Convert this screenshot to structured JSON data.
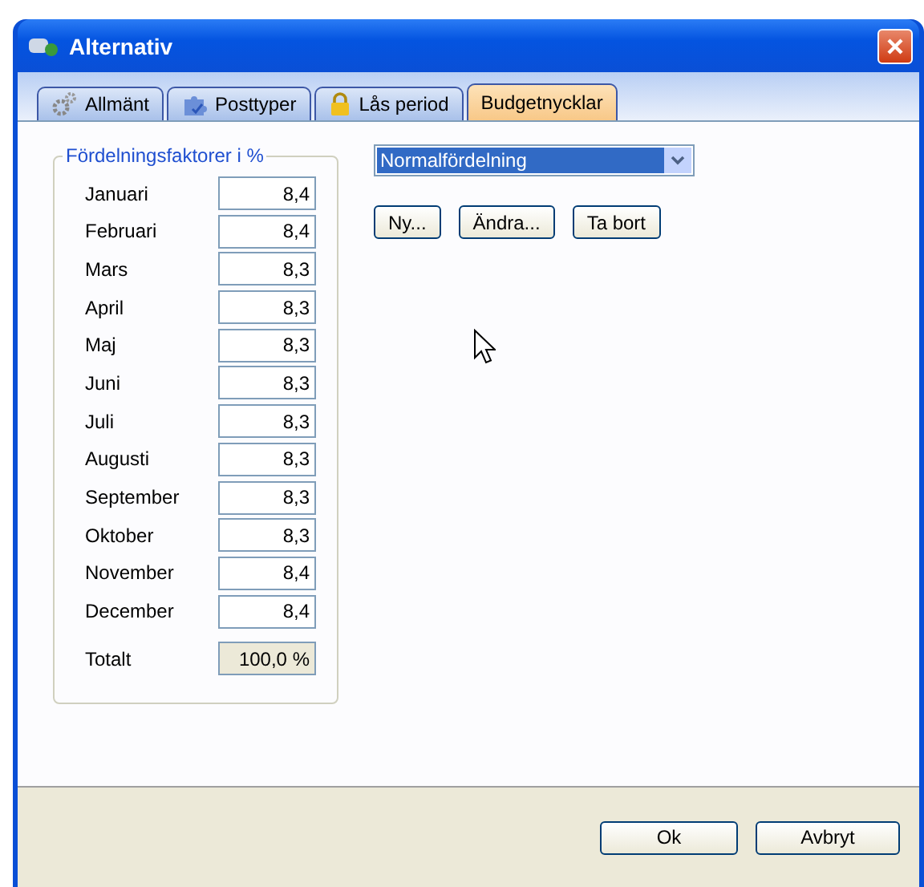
{
  "window": {
    "title": "Alternativ"
  },
  "tabs": [
    {
      "label": "Allmänt",
      "selected": false
    },
    {
      "label": "Posttyper",
      "selected": false
    },
    {
      "label": "Lås period",
      "selected": false
    },
    {
      "label": "Budgetnycklar",
      "selected": true
    }
  ],
  "group": {
    "title": "Fördelningsfaktorer i %",
    "rows": [
      {
        "label": "Januari",
        "value": "8,4"
      },
      {
        "label": "Februari",
        "value": "8,4"
      },
      {
        "label": "Mars",
        "value": "8,3"
      },
      {
        "label": "April",
        "value": "8,3"
      },
      {
        "label": "Maj",
        "value": "8,3"
      },
      {
        "label": "Juni",
        "value": "8,3"
      },
      {
        "label": "Juli",
        "value": "8,3"
      },
      {
        "label": "Augusti",
        "value": "8,3"
      },
      {
        "label": "September",
        "value": "8,3"
      },
      {
        "label": "Oktober",
        "value": "8,3"
      },
      {
        "label": "November",
        "value": "8,4"
      },
      {
        "label": "December",
        "value": "8,4"
      }
    ],
    "total": {
      "label": "Totalt",
      "value": "100,0 %"
    }
  },
  "key_select": {
    "value": "Normalfördelning"
  },
  "key_buttons": [
    "Ny...",
    "Ändra...",
    "Ta bort"
  ],
  "buttons": [
    "Ok",
    "Avbryt"
  ]
}
